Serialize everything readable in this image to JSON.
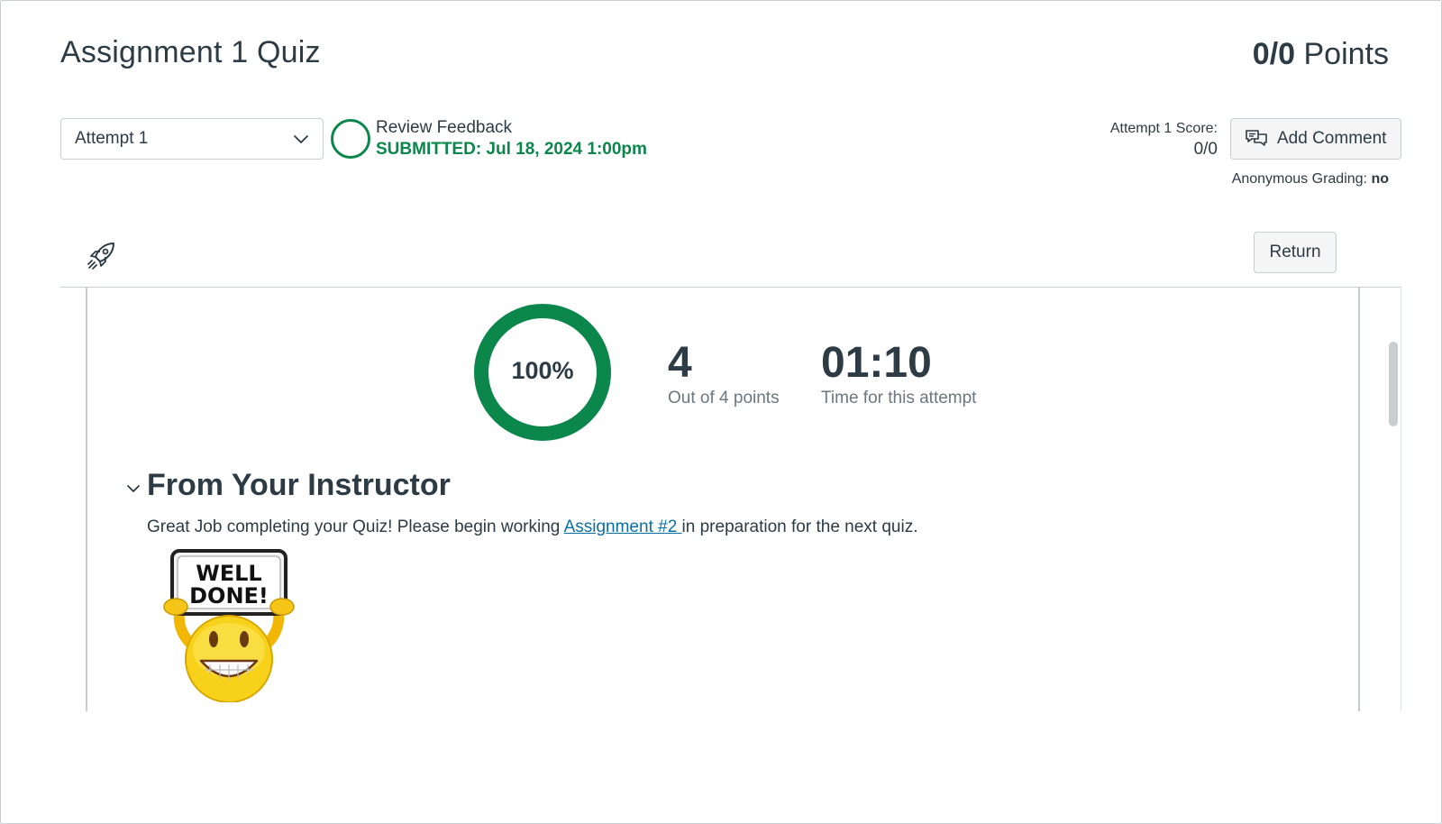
{
  "header": {
    "title": "Assignment 1 Quiz",
    "points_value": "0/0",
    "points_label": "Points"
  },
  "attempt_bar": {
    "attempt_select_value": "Attempt 1",
    "review_label": "Review Feedback",
    "submitted_text": "SUBMITTED: Jul 18, 2024 1:00pm",
    "score_label": "Attempt 1 Score:",
    "score_value": "0/0",
    "add_comment_label": "Add Comment",
    "anonymous_label": "Anonymous Grading:",
    "anonymous_value": "no"
  },
  "toolbar": {
    "return_label": "Return"
  },
  "results": {
    "percent": "100%",
    "score_fraction": 1.0,
    "points": "4",
    "points_label": "Out of 4 points",
    "time": "01:10",
    "time_label": "Time for this attempt"
  },
  "instructor": {
    "section_title": "From Your Instructor",
    "feedback_before": "Great Job completing your Quiz! Please begin working ",
    "feedback_link": "Assignment #2 ",
    "feedback_after": "in preparation for the next quiz.",
    "image_sign_text": "WELL DONE!"
  },
  "colors": {
    "success_green": "#0b874b",
    "link_blue": "#0770a3",
    "text_dark": "#2d3b45",
    "text_muted": "#6b7780",
    "border": "#c7cdd1"
  },
  "icons": {
    "attempt_chevron": "chevron-down-icon",
    "status": "circle-outline-icon",
    "add_comment": "comment-icon",
    "rocket": "rocket-icon",
    "section_toggle": "chevron-down-icon"
  }
}
